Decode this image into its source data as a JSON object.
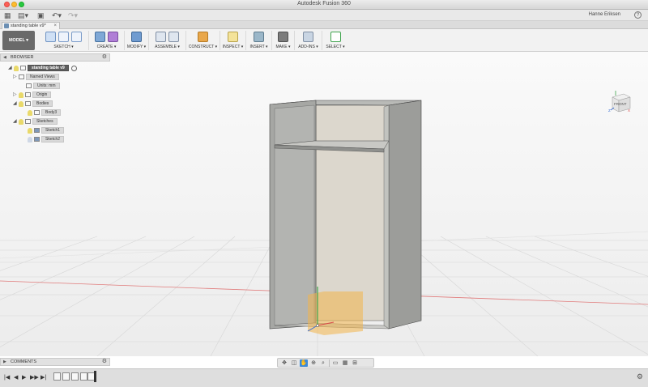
{
  "window": {
    "title": "Autodesk Fusion 360",
    "user": "Hanne Eriksen",
    "help_label": "?"
  },
  "tabs": [
    {
      "label": "standing table v9*",
      "close": "×"
    }
  ],
  "ribbon": {
    "mode": "MODEL ▾",
    "groups": [
      {
        "label": "SKETCH ▾"
      },
      {
        "label": "CREATE ▾"
      },
      {
        "label": "MODIFY ▾"
      },
      {
        "label": "ASSEMBLE ▾"
      },
      {
        "label": "CONSTRUCT ▾"
      },
      {
        "label": "INSPECT ▾"
      },
      {
        "label": "INSERT ▾"
      },
      {
        "label": "MAKE ▾"
      },
      {
        "label": "ADD-INS ▾"
      },
      {
        "label": "SELECT ▾"
      }
    ]
  },
  "browser": {
    "header": "BROWSER",
    "items": [
      {
        "label": "standing table v9"
      },
      {
        "label": "Named Views"
      },
      {
        "label": "Units: mm"
      },
      {
        "label": "Origin"
      },
      {
        "label": "Bodies"
      },
      {
        "label": "Body3"
      },
      {
        "label": "Sketches"
      },
      {
        "label": "Sketch1"
      },
      {
        "label": "Sketch2"
      }
    ]
  },
  "viewcube": {
    "face_label": "FRONT",
    "axis_x": "X",
    "axis_z": "Z"
  },
  "comments": {
    "header": "COMMENTS"
  },
  "navbar": {
    "icons": [
      "orbit-icon",
      "look-at-icon",
      "pan-icon",
      "zoom-icon",
      "zoom-window-icon",
      "display-settings-icon",
      "grid-icon",
      "viewports-icon"
    ]
  },
  "timeline": {
    "controls": [
      "|◀",
      "◀",
      "▶",
      "▶▶",
      "▶|"
    ],
    "feature_count": 5
  }
}
